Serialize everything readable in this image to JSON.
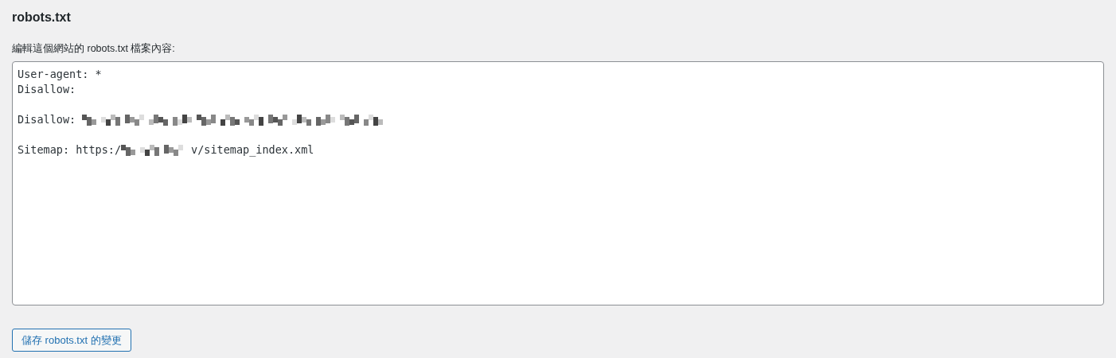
{
  "heading": "robots.txt",
  "field_label": "編輯這個網站的 robots.txt 檔案內容:",
  "editor": {
    "lines": [
      {
        "kind": "code",
        "segments": [
          {
            "kind": "text",
            "text": "User-agent: *"
          }
        ]
      },
      {
        "kind": "code",
        "segments": [
          {
            "kind": "text",
            "text": "Disallow:"
          }
        ]
      },
      {
        "kind": "blank"
      },
      {
        "kind": "code",
        "segments": [
          {
            "kind": "text",
            "text": "Disallow: "
          },
          {
            "kind": "redacted"
          }
        ]
      },
      {
        "kind": "blank"
      },
      {
        "kind": "code",
        "segments": [
          {
            "kind": "text",
            "text": "Sitemap: https:/"
          },
          {
            "kind": "redacted"
          },
          {
            "kind": "text",
            "text": "v/sitemap_index.xml"
          }
        ]
      }
    ]
  },
  "save_button": "儲存 robots.txt 的變更"
}
